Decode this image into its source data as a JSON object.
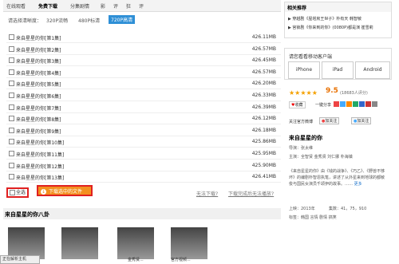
{
  "tabs": [
    "在线观看",
    "免费下载",
    "分集剧情",
    "影",
    "评",
    "狂",
    "评"
  ],
  "resolution": {
    "label": "请选择清晰度：",
    "options": [
      "320P流畅",
      "480P标清",
      "720P高清"
    ],
    "selected": "720P高清"
  },
  "episodes": [
    {
      "name": "来自星星的你[第1集]",
      "size": "426.11MB"
    },
    {
      "name": "来自星星的你[第2集]",
      "size": "426.57MB"
    },
    {
      "name": "来自星星的你[第3集]",
      "size": "426.45MB"
    },
    {
      "name": "来自星星的你[第4集]",
      "size": "426.57MB"
    },
    {
      "name": "来自星星的你[第5集]",
      "size": "426.20MB"
    },
    {
      "name": "来自星星的你[第6集]",
      "size": "426.33MB"
    },
    {
      "name": "来自星星的你[第7集]",
      "size": "426.39MB"
    },
    {
      "name": "来自星星的你[第8集]",
      "size": "426.12MB"
    },
    {
      "name": "来自星星的你[第9集]",
      "size": "426.18MB"
    },
    {
      "name": "来自星星的你[第10集]",
      "size": "425.86MB"
    },
    {
      "name": "来自星星的你[第11集]",
      "size": "425.95MB"
    },
    {
      "name": "来自星星的你[第12集]",
      "size": "425.90MB"
    },
    {
      "name": "来自星星的你[第13集]",
      "size": "426.41MB"
    }
  ],
  "bottom": {
    "select_all": "全选",
    "download": "下载选中的文件",
    "cant_download": "无法下载?",
    "no_player": "下载完成后无法播放?"
  },
  "flowers": {
    "title": "来自星星的你八卦",
    "captions": [
      "",
      "",
      "金秀贤...",
      "官方视频..."
    ]
  },
  "status": "正在解析主机",
  "related": {
    "title": "相关推荐",
    "items": [
      "▶ 穿越剧《屋塔房王世子》朴有天 韩智敏",
      "▶ 宫锁剧《你来到的你》(0080P)都是演 崔雪莉"
    ]
  },
  "client": {
    "title": "请您看看移动客户端",
    "buttons": [
      "iPhone",
      "iPad",
      "Android"
    ]
  },
  "rating": {
    "stars": "★★★★★",
    "score": "9.5",
    "votes": "(18683人评分)"
  },
  "actions": {
    "fav": "收藏",
    "share": "一键分享"
  },
  "official": {
    "label": "关注官方微博",
    "weibo": "加关注",
    "qq": "加关注"
  },
  "drama": {
    "title": "来自星星的你",
    "director": "导演：张太维",
    "cast": "主演：全智贤  金秀贤  刘仁娜  朴海镇",
    "description": "《来自星星的你》由《钱的战争》、《巧乙》、《野兽不够坏》的编剧朴智恩执笔，讲述了从外星来到地球的都敏俊与国民女演员千颂伊的故事。……",
    "more": "更多",
    "year": "上映：2013年",
    "episodes": "集数：41，75，910",
    "tags": "标签：韩国  言情  剧情  搞笑"
  },
  "colors": {
    "accent": "#2e8fd6",
    "download": "#f39020",
    "highlight": "#e02020",
    "star": "#f4a000"
  }
}
